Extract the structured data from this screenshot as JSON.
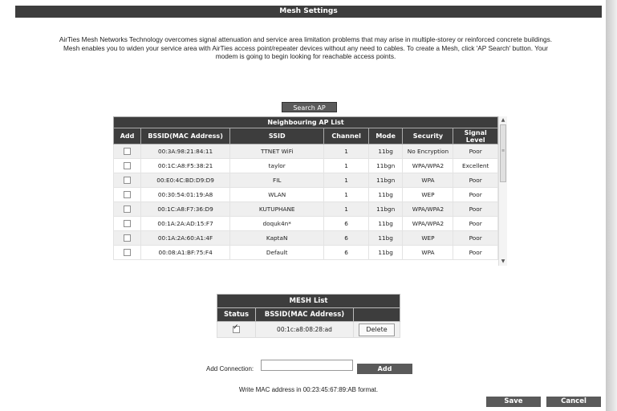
{
  "page": {
    "title": "Mesh Settings"
  },
  "description": "AirTies Mesh Networks Technology overcomes signal attenuation and service area limitation problems that may arise in multiple-storey or reinforced concrete buildings. Mesh enables you to widen your service area with AirTies access point/repeater devices without any need to cables. To create a Mesh, click 'AP Search' button. Your modem is going to begin looking for reachable access points.",
  "search_button": "Search AP",
  "ap_list": {
    "caption": "Neighbouring AP List",
    "headers": [
      "Add",
      "BSSID(MAC Address)",
      "SSID",
      "Channel",
      "Mode",
      "Security",
      "Signal Level"
    ],
    "rows": [
      {
        "checked": false,
        "bssid": "00:3A:98:21:84:11",
        "ssid": "TTNET WiFi",
        "channel": "1",
        "mode": "11bg",
        "security": "No Encryption",
        "signal": "Poor"
      },
      {
        "checked": false,
        "bssid": "00:1C:A8:F5:38:21",
        "ssid": "taylor",
        "channel": "1",
        "mode": "11bgn",
        "security": "WPA/WPA2",
        "signal": "Excellent"
      },
      {
        "checked": false,
        "bssid": "00:E0:4C:BD:D9:D9",
        "ssid": "FIL",
        "channel": "1",
        "mode": "11bgn",
        "security": "WPA",
        "signal": "Poor"
      },
      {
        "checked": false,
        "bssid": "00:30:54:01:19:A8",
        "ssid": "WLAN",
        "channel": "1",
        "mode": "11bg",
        "security": "WEP",
        "signal": "Poor"
      },
      {
        "checked": false,
        "bssid": "00:1C:A8:F7:36:D9",
        "ssid": "KUTUPHANE",
        "channel": "1",
        "mode": "11bgn",
        "security": "WPA/WPA2",
        "signal": "Poor"
      },
      {
        "checked": false,
        "bssid": "00:1A:2A:AD:15:F7",
        "ssid": "doquk4n*",
        "channel": "6",
        "mode": "11bg",
        "security": "WPA/WPA2",
        "signal": "Poor"
      },
      {
        "checked": false,
        "bssid": "00:1A:2A:60:A1:4F",
        "ssid": "KaptaN",
        "channel": "6",
        "mode": "11bg",
        "security": "WEP",
        "signal": "Poor"
      },
      {
        "checked": false,
        "bssid": "00:08:A1:BF:75:F4",
        "ssid": "Default",
        "channel": "6",
        "mode": "11bg",
        "security": "WPA",
        "signal": "Poor"
      }
    ]
  },
  "mesh_list": {
    "caption": "MESH List",
    "headers": [
      "Status",
      "BSSID(MAC Address)",
      ""
    ],
    "rows": [
      {
        "checked": true,
        "bssid": "00:1c:a8:08:28:ad",
        "action": "Delete"
      }
    ]
  },
  "add_connection": {
    "label": "Add Connection:",
    "value": "",
    "button": "Add",
    "hint": "Write MAC address in 00:23:45:67:89:AB format."
  },
  "buttons": {
    "save": "Save",
    "cancel": "Cancel"
  },
  "icons": {
    "scroll_up": "triangle-up",
    "scroll_down": "triangle-down",
    "checkbox": "checkbox"
  },
  "colors": {
    "header_bg": "#3d3d3d",
    "button_bg": "#5a5a5a",
    "row_alt": "#efefef"
  }
}
